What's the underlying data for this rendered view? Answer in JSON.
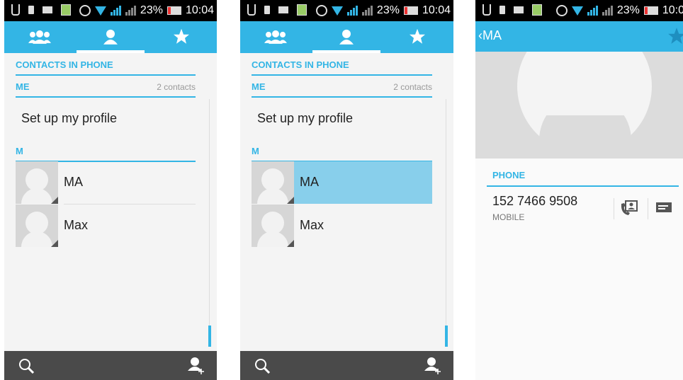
{
  "status_bar": {
    "battery": "23%",
    "time": "10:04",
    "time_cropped": "10:0"
  },
  "tabs": [
    {
      "name": "groups",
      "icon": "groups-icon"
    },
    {
      "name": "all-contacts",
      "icon": "person-icon"
    },
    {
      "name": "favorites",
      "icon": "star-icon"
    }
  ],
  "contacts": {
    "section_title": "CONTACTS IN PHONE",
    "me_header": "ME",
    "count_label": "2 contacts",
    "profile_label": "Set up my profile",
    "letter_header": "M",
    "items": [
      {
        "name": "MA"
      },
      {
        "name": "Max"
      }
    ]
  },
  "bottom_bar": {
    "left_icon": "search-icon",
    "right_icon": "add-contact-icon"
  },
  "detail": {
    "back_label": "MA",
    "phone_header": "PHONE",
    "phone_number": "152 7466 9508",
    "phone_type": "MOBILE"
  },
  "colors": {
    "accent": "#33b5e5",
    "highlight": "#88cfeb",
    "bottom_bar": "#4a4a4a"
  }
}
